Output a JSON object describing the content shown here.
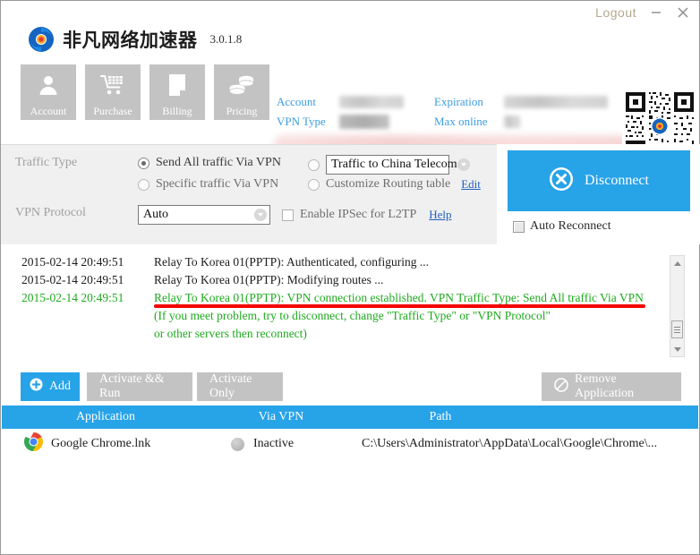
{
  "window": {
    "logout_label": "Logout",
    "minimize_icon": "minimize-icon",
    "close_icon": "close-icon"
  },
  "header": {
    "brand_name": "非凡网络加速器",
    "version": "3.0.1.8",
    "logo_icon": "swirl-logo-icon",
    "qr_icon": "qr-code-icon",
    "nav": [
      {
        "label": "Account",
        "icon": "user-icon"
      },
      {
        "label": "Purchase",
        "icon": "shopping-cart-icon"
      },
      {
        "label": "Billing",
        "icon": "document-icon"
      },
      {
        "label": "Pricing",
        "icon": "coins-icon"
      }
    ],
    "account_label": "Account",
    "account_value": "",
    "vpn_type_label": "VPN Type",
    "vpn_type_value": "",
    "expiration_label": "Expiration",
    "expiration_value": "",
    "max_online_label": "Max online",
    "max_online_value": ""
  },
  "settings": {
    "traffic_type_label": "Traffic Type",
    "radio_send_all": "Send All traffic Via VPN",
    "radio_specific": "Specific traffic Via VPN",
    "radio_china_telecom_selected": "Traffic to China Telecom",
    "radio_customize_routing": "Customize Routing table",
    "edit_link": "Edit",
    "vpn_protocol_label": "VPN Protocol",
    "vpn_protocol_value": "Auto",
    "ipsec_label": "Enable IPSec for L2TP",
    "help_link": "Help"
  },
  "connection": {
    "disconnect_label": "Disconnect",
    "disconnect_icon": "cancel-circle-icon",
    "auto_reconnect_label": "Auto Reconnect",
    "accent_color": "#27a3e8"
  },
  "log": {
    "lines": [
      {
        "ts": "2015-02-14 20:49:51",
        "msg": "Relay To Korea 01(PPTP): Authenticated, configuring ...",
        "color": "black",
        "underline": false
      },
      {
        "ts": "2015-02-14 20:49:51",
        "msg": "Relay To Korea 01(PPTP): Modifying routes ...",
        "color": "black",
        "underline": false
      },
      {
        "ts": "2015-02-14 20:49:51",
        "msg": "Relay To Korea 01(PPTP): VPN connection established. VPN Traffic Type: Send All traffic Via VPN",
        "color": "green",
        "underline": true
      },
      {
        "ts": "",
        "msg": "(If you meet problem, try to disconnect, change \"Traffic Type\" or \"VPN Protocol\"",
        "color": "green",
        "underline": false
      },
      {
        "ts": "",
        "msg": "  or other servers then reconnect)",
        "color": "green",
        "underline": false
      }
    ],
    "highlight_color": "#f40000",
    "success_color": "#1faa1f"
  },
  "toolbar": {
    "add_label": "Add",
    "add_icon": "plus-circle-icon",
    "activate_run_label": "Activate && Run",
    "activate_only_label": "Activate Only",
    "remove_label": "Remove Application",
    "remove_icon": "no-entry-icon"
  },
  "table": {
    "columns": [
      "Application",
      "Via VPN",
      "Path"
    ],
    "rows": [
      {
        "icon": "chrome-icon",
        "application": "Google Chrome.lnk",
        "via_vpn": "Inactive",
        "path": "C:\\Users\\Administrator\\AppData\\Local\\Google\\Chrome\\..."
      }
    ]
  }
}
